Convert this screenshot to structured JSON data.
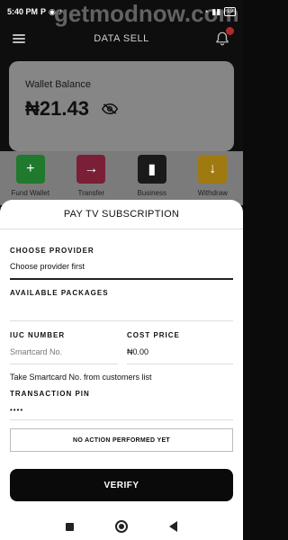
{
  "status_bar": {
    "time": "5:40 PM",
    "indicators": "P",
    "battery": "99"
  },
  "watermark": "getmodnow.com",
  "header": {
    "title": "DATA SELL"
  },
  "wallet": {
    "label": "Wallet Balance",
    "amount": "₦21.43"
  },
  "actions": [
    {
      "label": "Fund Wallet",
      "color": "#1f7a2e",
      "icon": "+"
    },
    {
      "label": "Transfer",
      "color": "#7a1f36",
      "icon": "→"
    },
    {
      "label": "Business",
      "color": "#1a1a1a",
      "icon": "▮"
    },
    {
      "label": "Withdraw",
      "color": "#a07a10",
      "icon": "↓"
    }
  ],
  "sheet": {
    "title": "PAY TV SUBSCRIPTION",
    "provider_label": "CHOOSE PROVIDER",
    "provider_value": "Choose provider first",
    "packages_label": "AVAILABLE PACKAGES",
    "iuc_label": "IUC NUMBER",
    "iuc_placeholder": "Smartcard No.",
    "cost_label": "COST PRICE",
    "cost_value": "₦0.00",
    "customers_link": "Take Smartcard No. from customers list",
    "pin_label": "TRANSACTION PIN",
    "pin_value": "••••",
    "status_text": "NO ACTION PERFORMED YET",
    "verify_label": "VERIFY"
  }
}
